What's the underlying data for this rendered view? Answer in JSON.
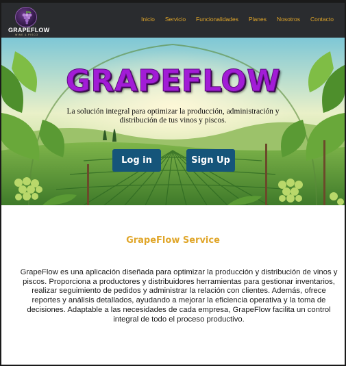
{
  "brand": {
    "name": "GRAPEFLOW",
    "tagline": "WINE & PISCO"
  },
  "nav": {
    "items": [
      "Inicio",
      "Servicio",
      "Funcionalidades",
      "Planes",
      "Nosotros",
      "Contacto"
    ]
  },
  "hero": {
    "title": "GRAPEFLOW",
    "subtitle": "La solución integral para optimizar la producción, administración y distribución de tus vinos y piscos.",
    "login_label": "Log in",
    "signup_label": "Sign Up"
  },
  "service": {
    "title": "GrapeFlow Service",
    "description": "GrapeFlow es una aplicación diseñada para optimizar la producción y distribución de vinos y piscos. Proporciona a productores y distribuidores herramientas para gestionar inventarios, realizar seguimiento de pedidos y administrar la relación con clientes. Además, ofrece reportes y análisis detallados, ayudando a mejorar la eficiencia operativa y la toma de decisiones. Adaptable a las necesidades de cada empresa, GrapeFlow facilita un control integral de todo el proceso productivo."
  },
  "colors": {
    "header_bg": "#2a2c2f",
    "accent": "#e0a62a",
    "title_purple": "#a21cd6",
    "button_bg": "#15557a"
  }
}
